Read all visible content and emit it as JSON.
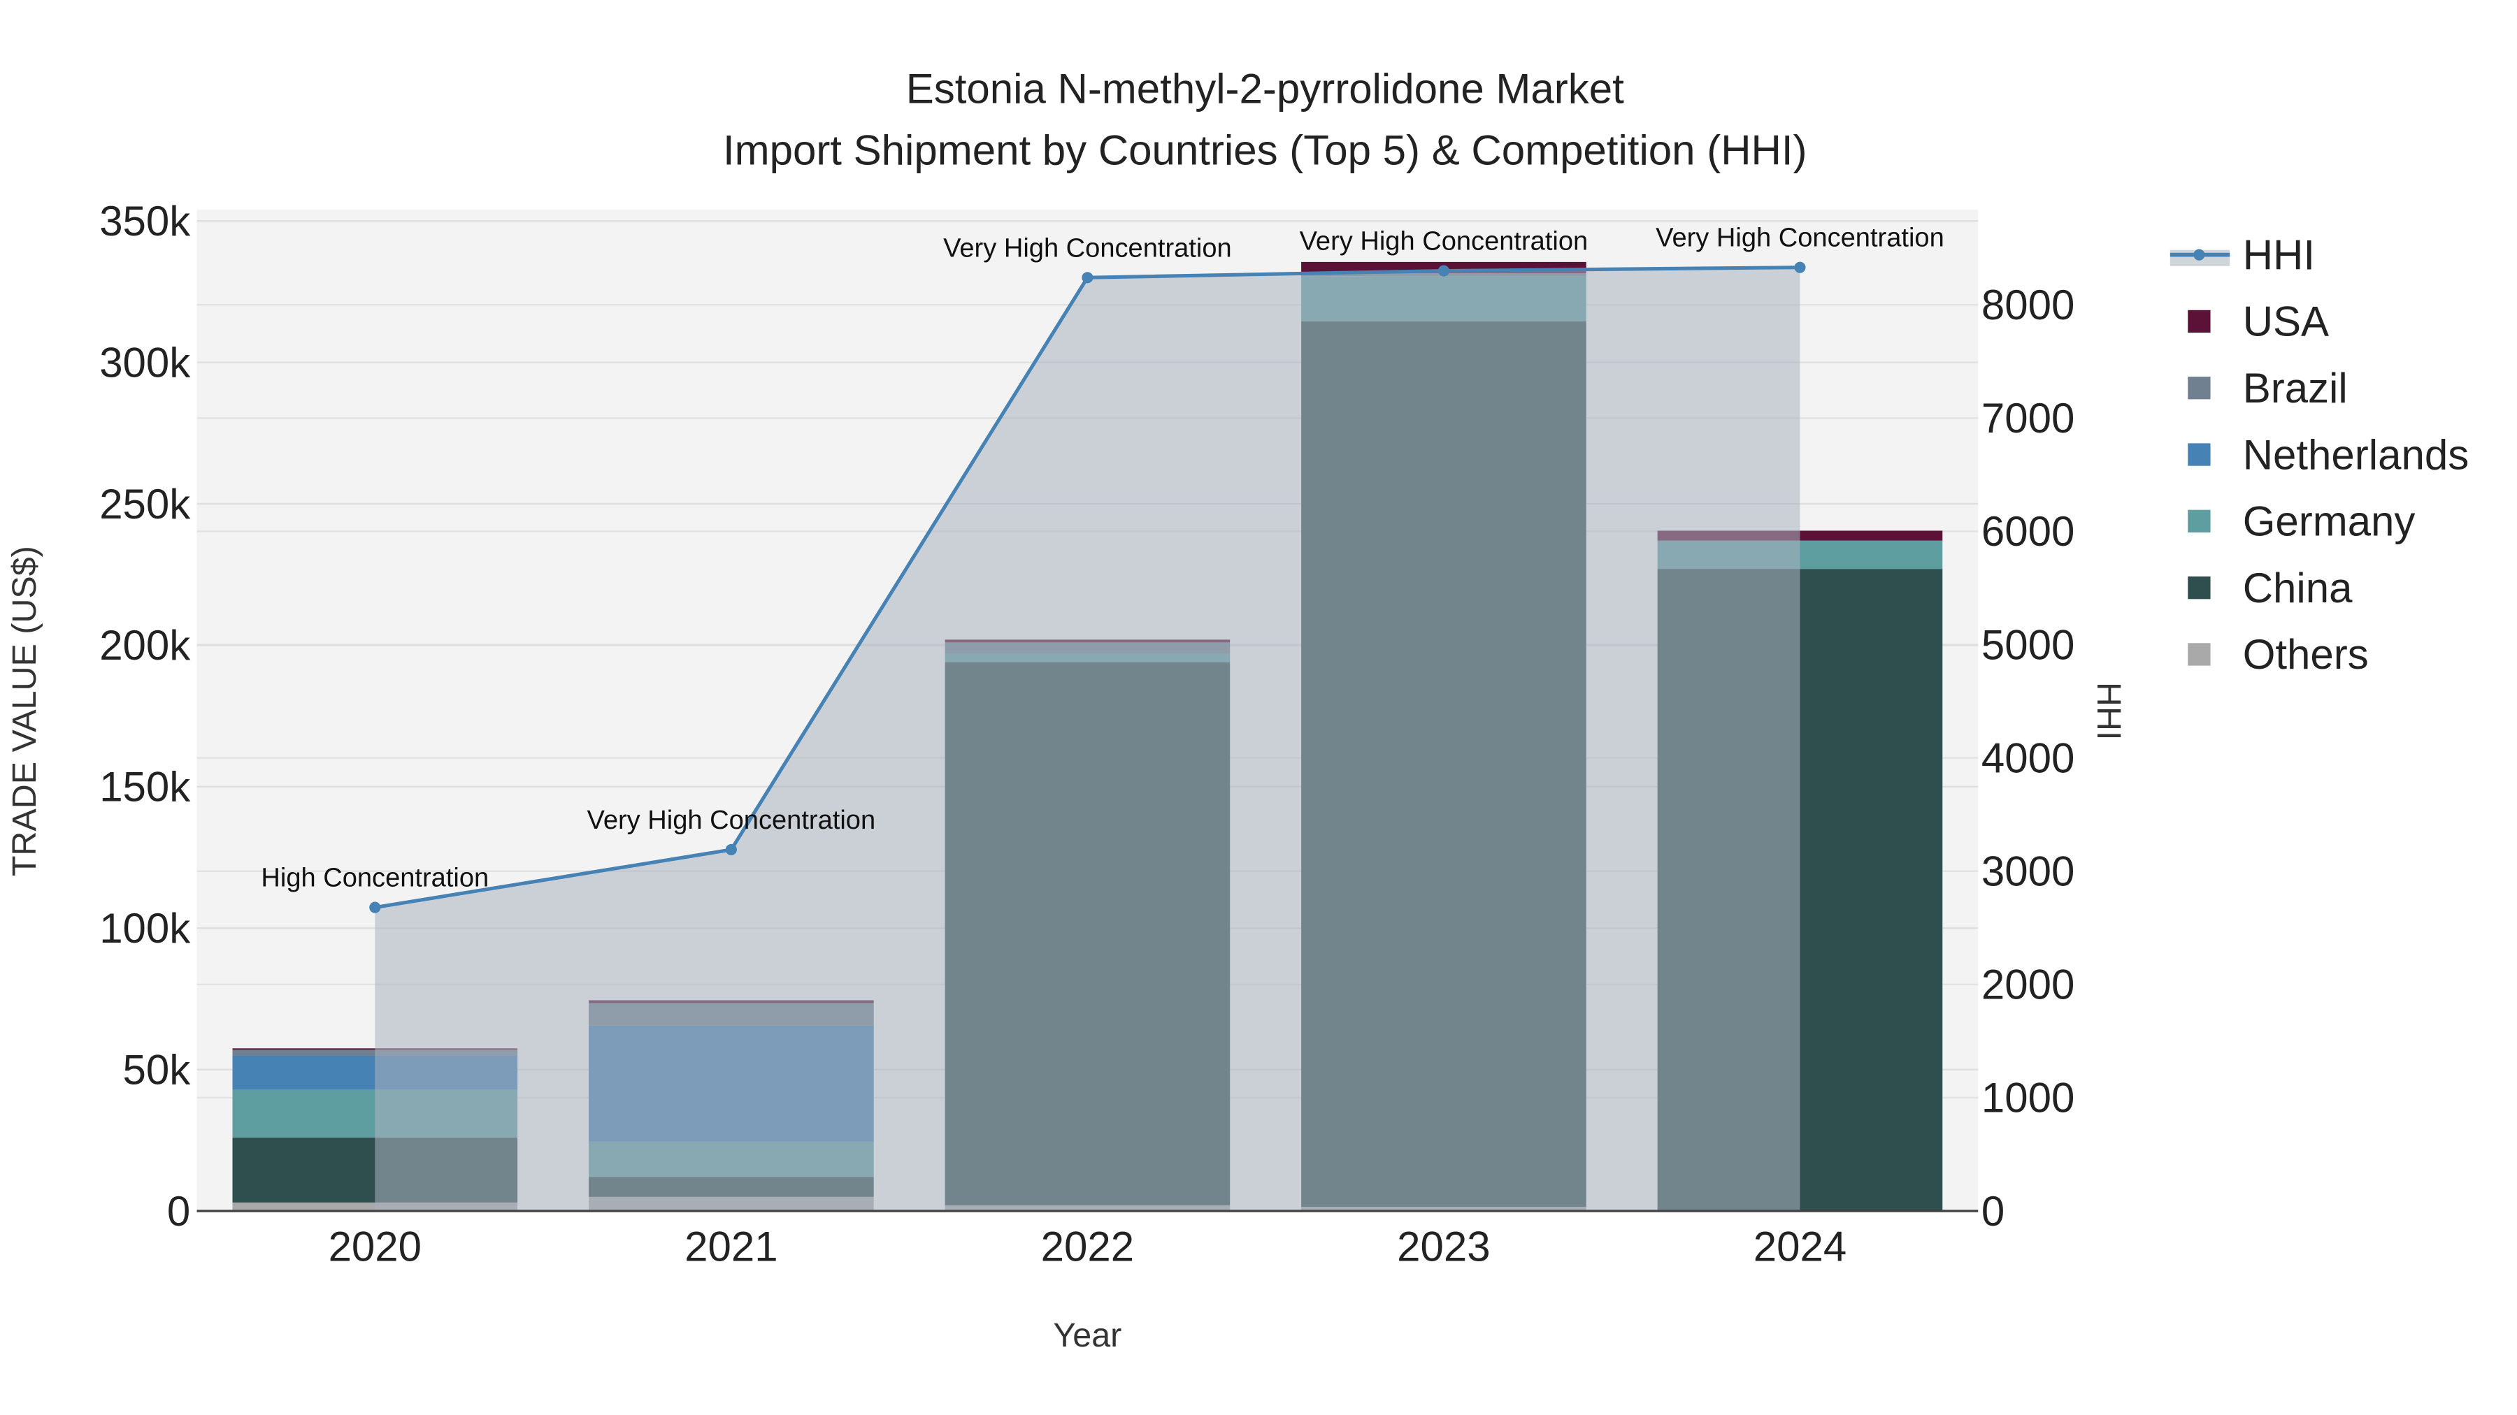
{
  "chart_data": {
    "type": "bar",
    "title": "Estonia N-methyl-2-pyrrolidone Market",
    "subtitle": "Import Shipment by Countries (Top 5) & Competition (HHI)",
    "xlabel": "Year",
    "ylabel": "TRADE VALUE (US$)",
    "y2label": "HHI",
    "categories": [
      "2020",
      "2021",
      "2022",
      "2023",
      "2024"
    ],
    "ylim": [
      0,
      354000
    ],
    "y2lim": [
      0,
      8840
    ],
    "yticks": [
      0,
      50000,
      100000,
      150000,
      200000,
      250000,
      300000,
      350000
    ],
    "ytick_labels": [
      "0",
      "50k",
      "100k",
      "150k",
      "200k",
      "250k",
      "300k",
      "350k"
    ],
    "y2ticks": [
      0,
      1000,
      2000,
      3000,
      4000,
      5000,
      6000,
      7000,
      8000
    ],
    "y2tick_labels": [
      "0",
      "1000",
      "2000",
      "3000",
      "4000",
      "5000",
      "6000",
      "7000",
      "8000"
    ],
    "grid": true,
    "stacked": true,
    "series": [
      {
        "name": "Others",
        "color": "#a9a9a9",
        "values": [
          3000,
          5000,
          2000,
          1500,
          0
        ]
      },
      {
        "name": "China",
        "color": "#2f4f4f",
        "values": [
          23000,
          7000,
          192000,
          313000,
          227000
        ]
      },
      {
        "name": "Germany",
        "color": "#5f9ea0",
        "values": [
          17000,
          12500,
          3000,
          16000,
          10000
        ]
      },
      {
        "name": "Netherlands",
        "color": "#4682b4",
        "values": [
          12000,
          41000,
          0,
          0,
          0
        ]
      },
      {
        "name": "Brazil",
        "color": "#708090",
        "values": [
          2000,
          8000,
          4000,
          1000,
          0
        ]
      },
      {
        "name": "USA",
        "color": "#5c1236",
        "values": [
          500,
          1000,
          1000,
          4000,
          3500
        ]
      }
    ],
    "hhi": {
      "name": "HHI",
      "color": "#4682b4",
      "values": [
        2680,
        3190,
        8240,
        8300,
        8330
      ],
      "annotations": [
        "High Concentration",
        "Very High Concentration",
        "Very High Concentration",
        "Very High Concentration",
        "Very High Concentration"
      ]
    },
    "legend": {
      "placement": "right",
      "entries": [
        "HHI",
        "USA",
        "Brazil",
        "Netherlands",
        "Germany",
        "China",
        "Others"
      ]
    }
  }
}
